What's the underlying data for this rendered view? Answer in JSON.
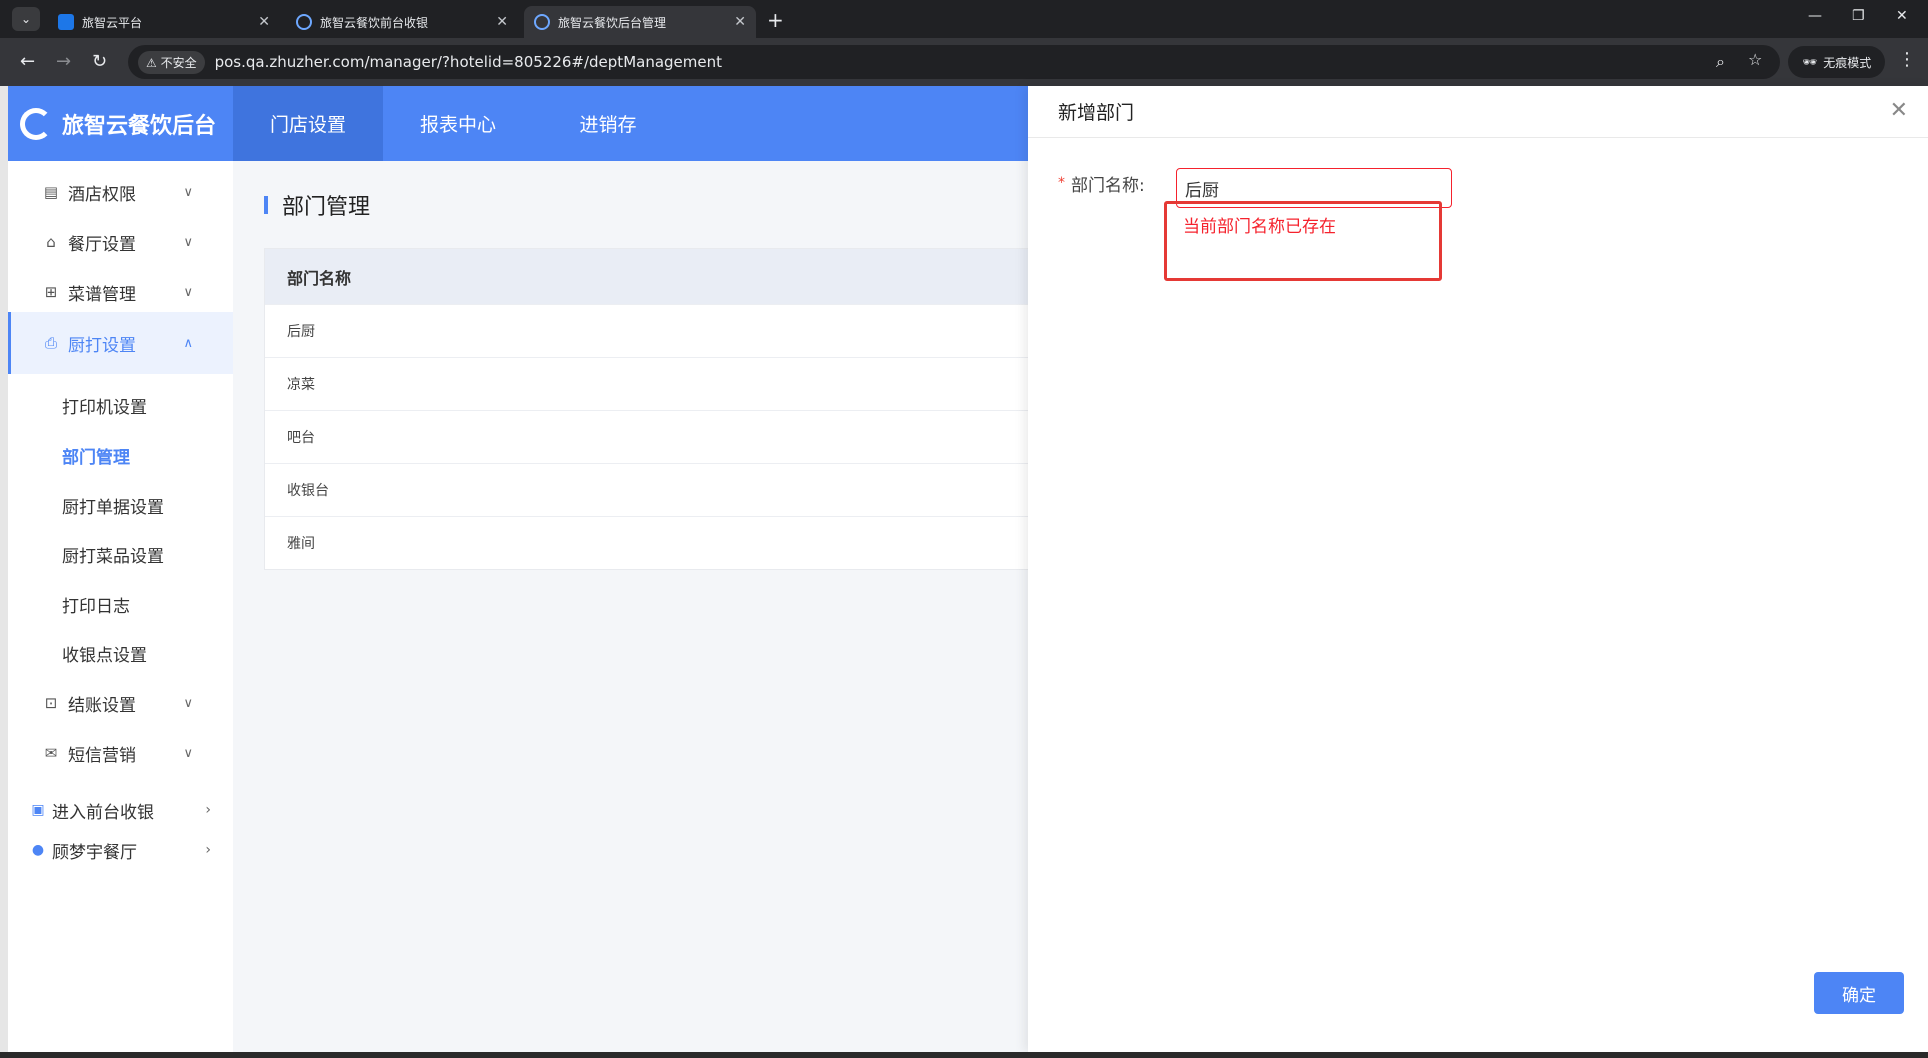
{
  "browser": {
    "tabs": [
      {
        "title": "旅智云平台"
      },
      {
        "title": "旅智云餐饮前台收银"
      },
      {
        "title": "旅智云餐饮后台管理"
      }
    ],
    "security_label": "不安全",
    "url": "pos.qa.zhuzher.com/manager/?hotelid=805226#/deptManagement",
    "incognito_label": "无痕模式"
  },
  "app": {
    "logo_text": "旅智云餐饮后台",
    "top_nav": [
      "门店设置",
      "报表中心",
      "进销存"
    ],
    "sidebar": {
      "groups": [
        {
          "label": "酒店权限"
        },
        {
          "label": "餐厅设置"
        },
        {
          "label": "菜谱管理"
        },
        {
          "label": "厨打设置"
        }
      ],
      "sub_items": [
        "打印机设置",
        "部门管理",
        "厨打单据设置",
        "厨打菜品设置",
        "打印日志",
        "收银点设置"
      ],
      "groups2": [
        {
          "label": "结账设置"
        },
        {
          "label": "短信营销"
        }
      ],
      "links": [
        "进入前台收银",
        "顾梦宇餐厅"
      ]
    },
    "page_title": "部门管理",
    "table": {
      "header": "部门名称",
      "rows": [
        "后厨",
        "凉菜",
        "吧台",
        "收银台",
        "雅间"
      ]
    }
  },
  "drawer": {
    "title": "新增部门",
    "required_mark": "*",
    "field_label": "部门名称:",
    "field_value": "后厨",
    "error_text": "当前部门名称已存在",
    "confirm_label": "确定"
  }
}
